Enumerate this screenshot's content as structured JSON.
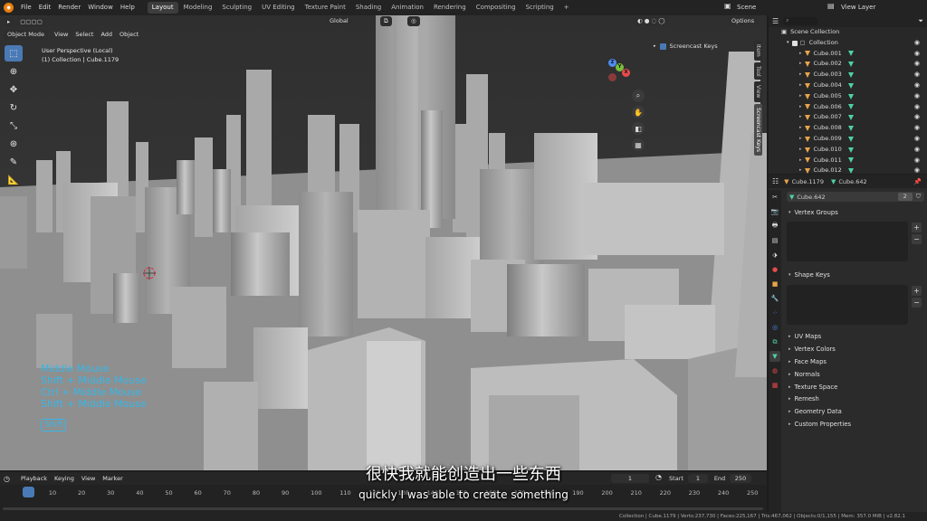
{
  "menu": [
    "File",
    "Edit",
    "Render",
    "Window",
    "Help"
  ],
  "workspaces": [
    "Layout",
    "Modeling",
    "Sculpting",
    "UV Editing",
    "Texture Paint",
    "Shading",
    "Animation",
    "Rendering",
    "Compositing",
    "Scripting",
    "+"
  ],
  "scene_label": "Scene",
  "view_layer_label": "View Layer",
  "viewport": {
    "mode": "Object Mode",
    "menus": [
      "View",
      "Select",
      "Add",
      "Object"
    ],
    "orientation": "Global",
    "options": "Options",
    "view_name": "User Perspective (Local)",
    "collection_info": "(1) Collection | Cube.1179",
    "screencast_label": "Screencast Keys",
    "ntabs": [
      "Item",
      "Tool",
      "View",
      "Screencast Keys"
    ]
  },
  "gizmo": {
    "x": "X",
    "y": "Y",
    "z": "Z"
  },
  "screencast_keys": [
    "Middle Mouse",
    "Shift + Middle Mouse",
    "Ctrl + Middle Mouse",
    "Shift + Middle Mouse"
  ],
  "screencast_badge": "Shift",
  "subtitle": {
    "cn": "很快我就能创造出一些东西",
    "en": "quickly I was able to create something"
  },
  "timeline": {
    "menus": [
      "Playback",
      "Keying",
      "View",
      "Marker"
    ],
    "current_frame": "1",
    "start_label": "Start",
    "start": "1",
    "end_label": "End",
    "end": "250",
    "ticks": [
      "1",
      "10",
      "20",
      "30",
      "40",
      "50",
      "60",
      "70",
      "80",
      "90",
      "100",
      "110",
      "120",
      "130",
      "140",
      "150",
      "160",
      "170",
      "180",
      "190",
      "200",
      "210",
      "220",
      "230",
      "240",
      "250"
    ]
  },
  "status": "Collection | Cube.1179 | Verts:237,730 | Faces:225,167 | Tris:467,062 | Objects:0/1,155 | Mem: 357.0 MiB | v2.82.1",
  "outliner": {
    "scene_collection": "Scene Collection",
    "collection": "Collection",
    "items": [
      "Cube.001",
      "Cube.002",
      "Cube.003",
      "Cube.004",
      "Cube.005",
      "Cube.006",
      "Cube.007",
      "Cube.008",
      "Cube.009",
      "Cube.010",
      "Cube.011",
      "Cube.012"
    ]
  },
  "properties": {
    "breadcrumb_a": "Cube.1179",
    "breadcrumb_b": "Cube.642",
    "mesh_name": "Cube.642",
    "users": "2",
    "panels_open": [
      "Vertex Groups",
      "Shape Keys"
    ],
    "panels_closed": [
      "UV Maps",
      "Vertex Colors",
      "Face Maps",
      "Normals",
      "Texture Space",
      "Remesh",
      "Geometry Data",
      "Custom Properties"
    ]
  },
  "colors": {
    "accent": "#4a7ab5",
    "screencast": "#36b7e8",
    "object_icon": "#e8a44a",
    "mesh_icon": "#4fd1a5"
  }
}
